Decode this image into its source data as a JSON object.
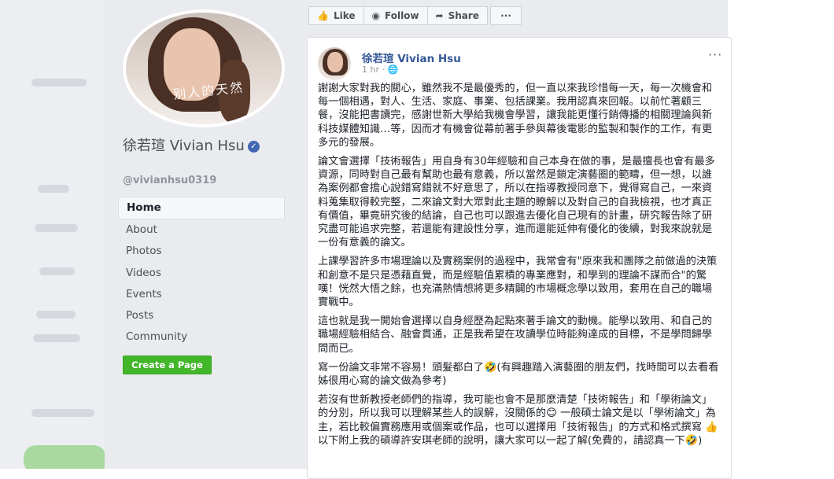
{
  "colors": {
    "link": "#365899",
    "green": "#42b72a",
    "verified": "#4267b2"
  },
  "page": {
    "name": "徐若瑄 Vivian Hsu",
    "handle": "@vivianhsu0319",
    "verified_icon": "verified-check-icon",
    "avatar_signature": "别人的天然"
  },
  "nav": {
    "items": [
      {
        "label": "Home",
        "active": true
      },
      {
        "label": "About"
      },
      {
        "label": "Photos"
      },
      {
        "label": "Videos"
      },
      {
        "label": "Events"
      },
      {
        "label": "Posts"
      },
      {
        "label": "Community"
      }
    ],
    "create_page": "Create a Page"
  },
  "actions": {
    "like": "Like",
    "follow": "Follow",
    "share": "Share",
    "more": "···"
  },
  "post": {
    "author": "徐若瑄 Vivian Hsu",
    "time": "1 hr · ",
    "menu": "···",
    "paragraphs": [
      "謝謝大家對我的關心，雖然我不是最優秀的，但一直以來我珍惜每一天，每一次機會和每一個相遇，對人、生活、家庭、事業、包括課業。我用認真來回報。以前忙著顧三餐，沒能把書讀完，感謝世新大學給我機會學習，讓我能更懂行銷傳播的相關理論與新科技媒體知識…等，因而才有機會從幕前著手參與幕後電影的監製和製作的工作，有更多元的發展。",
      "論文會選擇「技術報告」用自身有30年經驗和自己本身在做的事，是最擅長也會有最多資源，同時對自己最有幫助也最有意義，所以當然是鎖定演藝圈的範疇，但一想，以誰為案例都會擔心說錯寫錯就不好意思了，所以在指導教授同意下，覺得寫自己，一來資料蒐集取得較完整，二來論文對大眾對此主題的瞭解以及對自己的自我檢視，也才真正有價值，畢竟研究後的結論，自己也可以跟進去優化自己現有的計畫，研究報告除了研究盡可能追求完整，若還能有建設性分享，進而還能延伸有優化的後續，對我來說就是一份有意義的論文。",
      "上課學習許多市場理論以及實務案例的過程中，我常會有\"原來我和團隊之前做過的決策和創意不是只是憑藉直覺，而是經驗值累積的專業應對，和學到的理論不謀而合\"的驚嘆！恍然大悟之餘，也充滿熱情想將更多精闢的市場概念學以致用，套用在自己的職場實戰中。",
      "這也就是我一開始會選擇以自身經歷為起點來著手論文的動機。能學以致用、和自己的職場經驗相結合、融會貫通，正是我希望在攻讀學位時能夠達成的目標，不是學問歸學問而已。",
      "寫一份論文非常不容易！頭髮都白了🤣(有興趣踏入演藝圈的朋友們，找時間可以去看看姊很用心寫的論文做為參考)",
      "若沒有世新教授老師們的指導，我可能也會不是那麼清楚「技術報告」和「學術論文」的分別，所以我可以理解某些人的誤解，沒關係的😊 一般碩士論文是以「學術論文」為主，若比較偏實務應用或個案或作品，也可以選擇用「技術報告」的方式和格式撰寫 👍 以下附上我的碩導許安琪老師的說明，讓大家可以一起了解(免費的，請認真一下🤣)"
    ]
  }
}
